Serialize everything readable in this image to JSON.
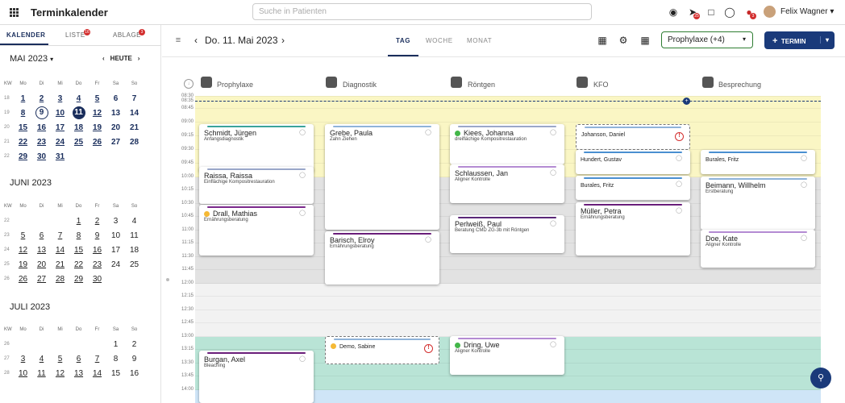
{
  "header": {
    "app_title": "Terminkalender",
    "search_placeholder": "Suche in Patienten",
    "user_name": "Felix Wagner",
    "badge_send": "25",
    "badge_users": "3"
  },
  "sidebar": {
    "tabs": [
      {
        "label": "KALENDER"
      },
      {
        "label": "LISTE",
        "badge": "16"
      },
      {
        "label": "ABLAGE",
        "badge": "3"
      }
    ],
    "today_label": "HEUTE",
    "months": [
      {
        "title": "MAI 2023",
        "weekdays": [
          "KW",
          "Mo",
          "Di",
          "Mi",
          "Do",
          "Fr",
          "Sa",
          "So"
        ],
        "rows": [
          [
            "18",
            "1",
            "2",
            "3",
            "4",
            "5",
            "6",
            "7"
          ],
          [
            "19",
            "8",
            "9",
            "10",
            "11",
            "12",
            "13",
            "14"
          ],
          [
            "20",
            "15",
            "16",
            "17",
            "18",
            "19",
            "20",
            "21"
          ],
          [
            "21",
            "22",
            "23",
            "24",
            "25",
            "26",
            "27",
            "28"
          ],
          [
            "22",
            "29",
            "30",
            "31",
            "",
            "",
            "",
            ""
          ]
        ]
      },
      {
        "title": "JUNI 2023",
        "weekdays": [
          "KW",
          "Mo",
          "Di",
          "Mi",
          "Do",
          "Fr",
          "Sa",
          "So"
        ],
        "rows": [
          [
            "22",
            "",
            "",
            "",
            "1",
            "2",
            "3",
            "4"
          ],
          [
            "23",
            "5",
            "6",
            "7",
            "8",
            "9",
            "10",
            "11"
          ],
          [
            "24",
            "12",
            "13",
            "14",
            "15",
            "16",
            "17",
            "18"
          ],
          [
            "25",
            "19",
            "20",
            "21",
            "22",
            "23",
            "24",
            "25"
          ],
          [
            "26",
            "26",
            "27",
            "28",
            "29",
            "30",
            "",
            ""
          ]
        ]
      },
      {
        "title": "JULI 2023",
        "weekdays": [
          "KW",
          "Mo",
          "Di",
          "Mi",
          "Do",
          "Fr",
          "Sa",
          "So"
        ],
        "rows": [
          [
            "26",
            "",
            "",
            "",
            "",
            "",
            "1",
            "2"
          ],
          [
            "27",
            "3",
            "4",
            "5",
            "6",
            "7",
            "8",
            "9"
          ],
          [
            "28",
            "10",
            "11",
            "12",
            "13",
            "14",
            "15",
            "16"
          ]
        ]
      }
    ]
  },
  "toolbar": {
    "date": "Do. 11. Mai 2023",
    "views": [
      "TAG",
      "WOCHE",
      "MONAT"
    ],
    "filter": "Prophylaxe (+4)",
    "new_button": "TERMIN"
  },
  "resources": [
    "Prophylaxe",
    "Diagnostik",
    "Röntgen",
    "KFO",
    "Besprechung"
  ],
  "times": [
    "08:30",
    "08:35",
    "08:45",
    "09:00",
    "09:15",
    "09:30",
    "09:45",
    "10:00",
    "10:15",
    "10:30",
    "10:45",
    "11:00",
    "11:15",
    "11:30",
    "11:45",
    "12:00",
    "12:15",
    "12:30",
    "12:45",
    "13:00",
    "13:15",
    "13:30",
    "13:45",
    "14:00"
  ],
  "colors": {
    "accent": "#1a2e5c",
    "yellow_band": "#faf6c4",
    "gray_band": "#e2e2e2",
    "light_band": "#f2f2f2",
    "teal_band": "#b9e4d6",
    "blue_band": "#cfe5f7",
    "green_dot": "#43b649",
    "orange_dot": "#f5b935",
    "warn": "#d32f2f"
  },
  "appointments": [
    {
      "name": "Schmidt, Jürgen",
      "desc": "Anfangsdiagnostik",
      "bar": "#3aa39a"
    },
    {
      "name": "Raissa, Raissa",
      "desc": "Einflächige Kompositrestauration",
      "bar": "#9aa7c9"
    },
    {
      "name": "Drall, Mathias",
      "desc": "Ernährungsberatung",
      "bar": "#7b2a8c",
      "dot": "#f5b935"
    },
    {
      "name": "Burgan, Axel",
      "desc": "Bleaching",
      "bar": "#6a1e7a"
    },
    {
      "name": "Grebe, Paula",
      "desc": "Zahn Ziehen",
      "bar": "#8fb3d9"
    },
    {
      "name": "Barisch, Elroy",
      "desc": "Ernährungsberatung",
      "bar": "#6a1e7a"
    },
    {
      "name": "Demo, Sabine",
      "desc": "",
      "bar": "#8fb3d9",
      "dot": "#f5b935"
    },
    {
      "name": "Kiees, Johanna",
      "desc": "dreiflächige Kompositrestauration",
      "bar": "#9aa7c9",
      "dot": "#43b649"
    },
    {
      "name": "Schlaussen, Jan",
      "desc": "Aligner Kontrolle",
      "bar": "#b48bd3"
    },
    {
      "name": "Perlweiß, Paul",
      "desc": "Beratung CMD ZG-3b mit Röntgen",
      "bar": "#5a2878"
    },
    {
      "name": "Dring, Uwe",
      "desc": "Aligner Kontrolle",
      "bar": "#b48bd3",
      "dot": "#43b649"
    },
    {
      "name": "Johanson, Daniel",
      "desc": "",
      "bar": "#8fb3d9"
    },
    {
      "name": "Hundert, Gustav",
      "desc": "",
      "bar": "#4a8fd1"
    },
    {
      "name": "Burales, Fritz",
      "desc": "",
      "bar": "#4a8fd1"
    },
    {
      "name": "Müller, Petra",
      "desc": "Ernährungsberatung",
      "bar": "#6a1e7a"
    },
    {
      "name": "Burales, Fritz",
      "desc": "",
      "bar": "#4a8fd1"
    },
    {
      "name": "Beimann, Willhelm",
      "desc": "Erstberatung",
      "bar": "#8fb3d9"
    },
    {
      "name": "Doe, Kate",
      "desc": "Aligner Kontrolle",
      "bar": "#b48bd3"
    }
  ]
}
